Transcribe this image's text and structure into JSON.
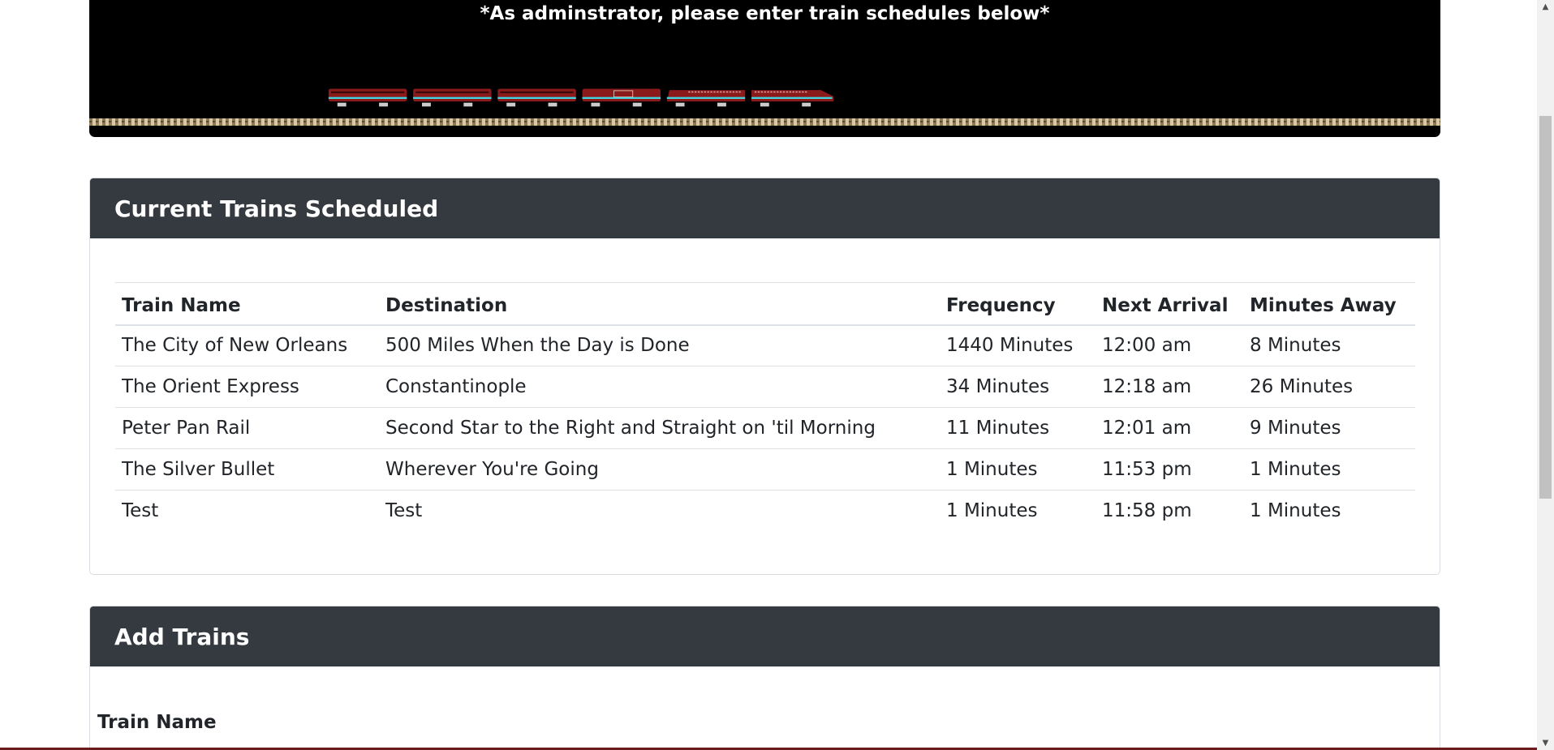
{
  "banner": {
    "text": "*As adminstrator, please enter train schedules below*"
  },
  "schedule_card": {
    "title": "Current Trains Scheduled",
    "columns": [
      "Train Name",
      "Destination",
      "Frequency",
      "Next Arrival",
      "Minutes Away"
    ],
    "rows": [
      [
        "The City of New Orleans",
        "500 Miles When the Day is Done",
        "1440 Minutes",
        "12:00 am",
        "8 Minutes"
      ],
      [
        "The Orient Express",
        "Constantinople",
        "34 Minutes",
        "12:18 am",
        "26 Minutes"
      ],
      [
        "Peter Pan Rail",
        "Second Star to the Right and Straight on 'til Morning",
        "11 Minutes",
        "12:01 am",
        "9 Minutes"
      ],
      [
        "The Silver Bullet",
        "Wherever You're Going",
        "1 Minutes",
        "11:53 pm",
        "1 Minutes"
      ],
      [
        "Test",
        "Test",
        "1 Minutes",
        "11:58 pm",
        "1 Minutes"
      ]
    ]
  },
  "add_card": {
    "title": "Add Trains",
    "train_name_label": "Train Name"
  },
  "colors": {
    "banner_bg": "#000000",
    "card_header_bg": "#343a40",
    "train_red": "#8b1a1a",
    "train_stripe": "#3fd4e0"
  }
}
